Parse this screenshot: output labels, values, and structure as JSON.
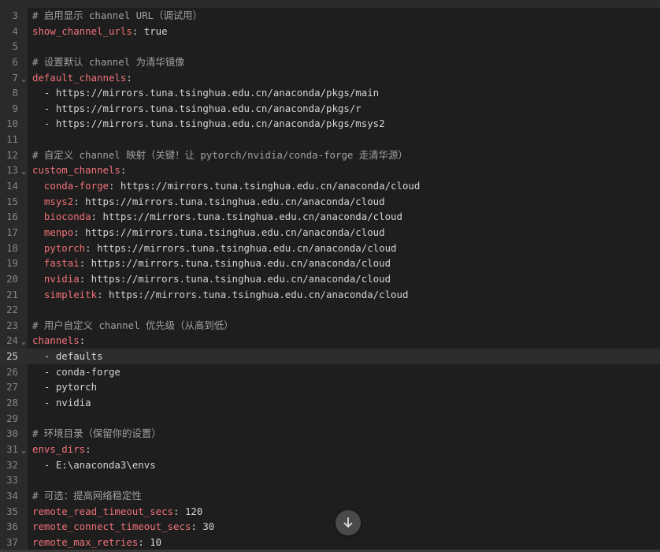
{
  "editor": {
    "active_line": 25,
    "lines": [
      {
        "n": "3",
        "key": "",
        "sep": "",
        "value": "",
        "comment": "# 启用显示 channel URL（调试用）",
        "fold": false
      },
      {
        "n": "4",
        "key": "show_channel_urls",
        "sep": ": ",
        "value": "true",
        "comment": "",
        "fold": false
      },
      {
        "n": "5",
        "key": "",
        "sep": "",
        "value": "",
        "comment": "",
        "fold": false
      },
      {
        "n": "6",
        "key": "",
        "sep": "",
        "value": "",
        "comment": "# 设置默认 channel 为清华镜像",
        "fold": false
      },
      {
        "n": "7",
        "key": "default_channels",
        "sep": ":",
        "value": "",
        "comment": "",
        "fold": true
      },
      {
        "n": "8",
        "key": "",
        "sep": "",
        "value": "  - https://mirrors.tuna.tsinghua.edu.cn/anaconda/pkgs/main",
        "comment": "",
        "fold": false
      },
      {
        "n": "9",
        "key": "",
        "sep": "",
        "value": "  - https://mirrors.tuna.tsinghua.edu.cn/anaconda/pkgs/r",
        "comment": "",
        "fold": false
      },
      {
        "n": "10",
        "key": "",
        "sep": "",
        "value": "  - https://mirrors.tuna.tsinghua.edu.cn/anaconda/pkgs/msys2",
        "comment": "",
        "fold": false
      },
      {
        "n": "11",
        "key": "",
        "sep": "",
        "value": "",
        "comment": "",
        "fold": false
      },
      {
        "n": "12",
        "key": "",
        "sep": "",
        "value": "",
        "comment": "# 自定义 channel 映射（关键！让 pytorch/nvidia/conda-forge 走清华源）",
        "fold": false
      },
      {
        "n": "13",
        "key": "custom_channels",
        "sep": ":",
        "value": "",
        "comment": "",
        "fold": true
      },
      {
        "n": "14",
        "key": "  conda-forge",
        "sep": ": ",
        "value": "https://mirrors.tuna.tsinghua.edu.cn/anaconda/cloud",
        "comment": "",
        "fold": false
      },
      {
        "n": "15",
        "key": "  msys2",
        "sep": ": ",
        "value": "https://mirrors.tuna.tsinghua.edu.cn/anaconda/cloud",
        "comment": "",
        "fold": false
      },
      {
        "n": "16",
        "key": "  bioconda",
        "sep": ": ",
        "value": "https://mirrors.tuna.tsinghua.edu.cn/anaconda/cloud",
        "comment": "",
        "fold": false
      },
      {
        "n": "17",
        "key": "  menpo",
        "sep": ": ",
        "value": "https://mirrors.tuna.tsinghua.edu.cn/anaconda/cloud",
        "comment": "",
        "fold": false
      },
      {
        "n": "18",
        "key": "  pytorch",
        "sep": ": ",
        "value": "https://mirrors.tuna.tsinghua.edu.cn/anaconda/cloud",
        "comment": "",
        "fold": false
      },
      {
        "n": "19",
        "key": "  fastai",
        "sep": ": ",
        "value": "https://mirrors.tuna.tsinghua.edu.cn/anaconda/cloud",
        "comment": "",
        "fold": false
      },
      {
        "n": "20",
        "key": "  nvidia",
        "sep": ": ",
        "value": "https://mirrors.tuna.tsinghua.edu.cn/anaconda/cloud",
        "comment": "",
        "fold": false
      },
      {
        "n": "21",
        "key": "  simpleitk",
        "sep": ": ",
        "value": "https://mirrors.tuna.tsinghua.edu.cn/anaconda/cloud",
        "comment": "",
        "fold": false
      },
      {
        "n": "22",
        "key": "",
        "sep": "",
        "value": "",
        "comment": "",
        "fold": false
      },
      {
        "n": "23",
        "key": "",
        "sep": "",
        "value": "",
        "comment": "# 用户自定义 channel 优先级（从高到低）",
        "fold": false
      },
      {
        "n": "24",
        "key": "channels",
        "sep": ":",
        "value": "",
        "comment": "",
        "fold": true
      },
      {
        "n": "25",
        "key": "",
        "sep": "",
        "value": "  - defaults",
        "comment": "",
        "fold": false
      },
      {
        "n": "26",
        "key": "",
        "sep": "",
        "value": "  - conda-forge",
        "comment": "",
        "fold": false
      },
      {
        "n": "27",
        "key": "",
        "sep": "",
        "value": "  - pytorch",
        "comment": "",
        "fold": false
      },
      {
        "n": "28",
        "key": "",
        "sep": "",
        "value": "  - nvidia",
        "comment": "",
        "fold": false
      },
      {
        "n": "29",
        "key": "",
        "sep": "",
        "value": "",
        "comment": "",
        "fold": false
      },
      {
        "n": "30",
        "key": "",
        "sep": "",
        "value": "",
        "comment": "# 环境目录（保留你的设置）",
        "fold": false
      },
      {
        "n": "31",
        "key": "envs_dirs",
        "sep": ":",
        "value": "",
        "comment": "",
        "fold": true
      },
      {
        "n": "32",
        "key": "",
        "sep": "",
        "value": "  - E:\\anaconda3\\envs",
        "comment": "",
        "fold": false
      },
      {
        "n": "33",
        "key": "",
        "sep": "",
        "value": "",
        "comment": "",
        "fold": false
      },
      {
        "n": "34",
        "key": "",
        "sep": "",
        "value": "",
        "comment": "# 可选：提高网络稳定性",
        "fold": false
      },
      {
        "n": "35",
        "key": "remote_read_timeout_secs",
        "sep": ": ",
        "value": "120",
        "comment": "",
        "fold": false
      },
      {
        "n": "36",
        "key": "remote_connect_timeout_secs",
        "sep": ": ",
        "value": "30",
        "comment": "",
        "fold": false
      },
      {
        "n": "37",
        "key": "remote_max_retries",
        "sep": ": ",
        "value": "10",
        "comment": "",
        "fold": false
      }
    ]
  },
  "scroll_button": {
    "icon": "arrow-down-icon"
  },
  "colors": {
    "background": "#1e1e1e",
    "key": "#f07178",
    "comment": "#a0a0a0",
    "text": "#d4d4d4",
    "line_number": "#858585"
  }
}
